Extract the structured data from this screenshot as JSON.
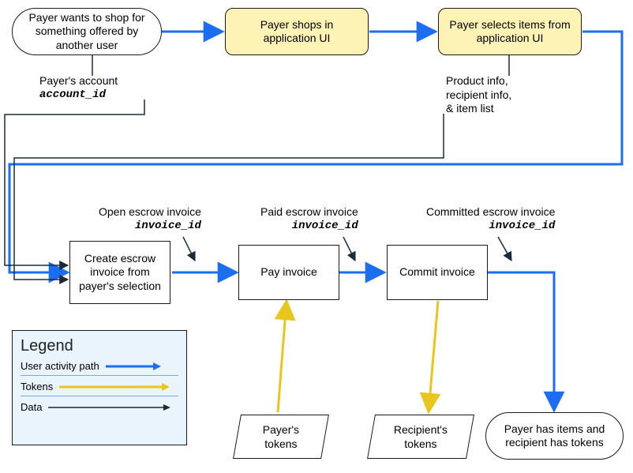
{
  "colors": {
    "user_activity": "#1b6ef0",
    "tokens": "#e9c61d",
    "data": "#1a2b3c",
    "yellow_fill": "#fdf3b4",
    "legend_fill": "#e9f4fd",
    "border": "#1a1a1a"
  },
  "nodes": {
    "start": {
      "text": "Payer wants to shop for something offered by another user"
    },
    "shops": {
      "text": "Payer shops in application UI"
    },
    "selects": {
      "text": "Payer selects items from application UI"
    },
    "create_escrow": {
      "text": "Create escrow invoice from payer's selection"
    },
    "pay_invoice": {
      "text": "Pay invoice"
    },
    "commit_invoice": {
      "text": "Commit invoice"
    },
    "payer_tokens": {
      "text": "Payer's tokens"
    },
    "recipient_tokens": {
      "text": "Recipient's tokens"
    },
    "end": {
      "text": "Payer has items and recipient has tokens"
    }
  },
  "data_labels": {
    "account": {
      "title": "Payer's account",
      "code": "account_id"
    },
    "product": {
      "title_line1": "Product info,",
      "title_line2": "recipient info,",
      "title_line3": "& item list"
    },
    "open": {
      "title": "Open escrow invoice",
      "code": "invoice_id"
    },
    "paid": {
      "title": "Paid escrow invoice",
      "code": "invoice_id"
    },
    "committed": {
      "title": "Committed escrow invoice",
      "code": "invoice_id"
    }
  },
  "legend": {
    "title": "Legend",
    "rows": {
      "user_activity": "User activity path",
      "tokens": "Tokens",
      "data": "Data"
    }
  }
}
